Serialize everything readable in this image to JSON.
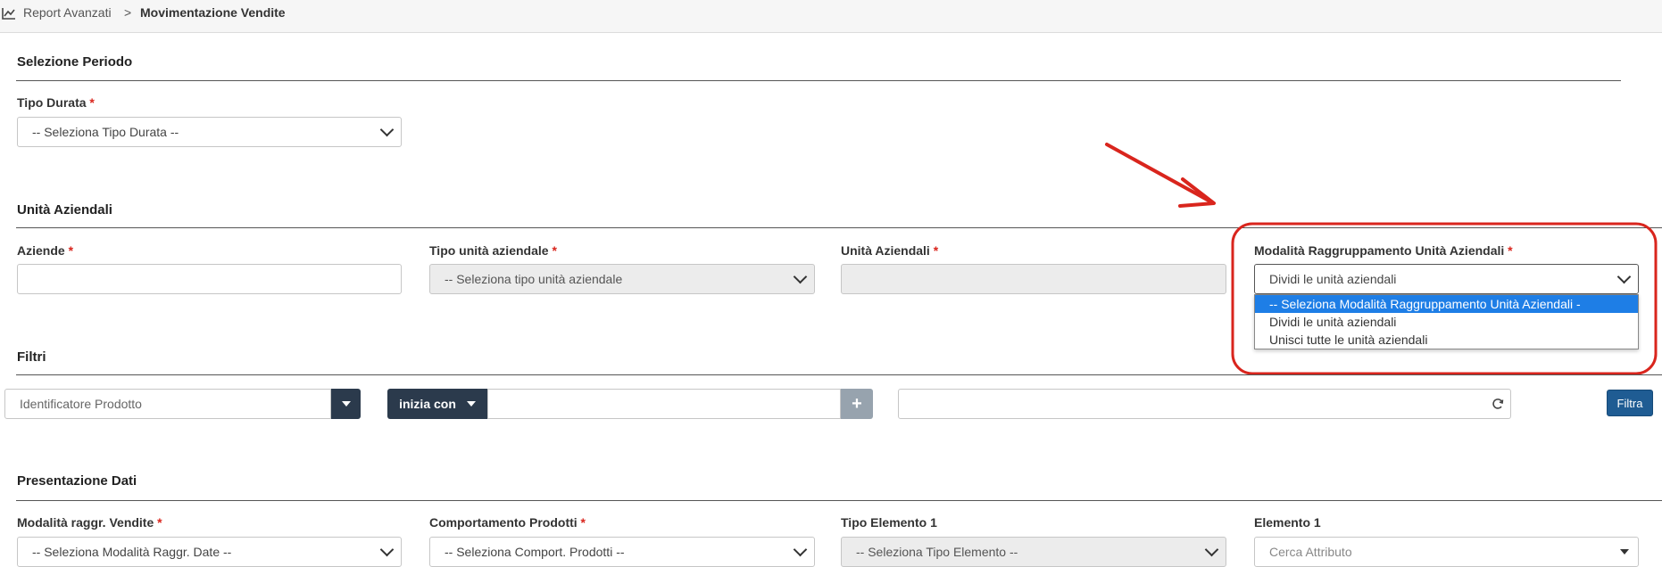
{
  "breadcrumb": {
    "parent": "Report Avanzati",
    "separator": ">",
    "current": "Movimentazione Vendite"
  },
  "sections": {
    "periodo": "Selezione Periodo",
    "unita": "Unità Aziendali",
    "filtri": "Filtri",
    "presentazione": "Presentazione Dati"
  },
  "required_mark": "*",
  "periodo": {
    "tipo_durata_label": "Tipo Durata",
    "tipo_durata_value": "-- Seleziona Tipo Durata --"
  },
  "unita": {
    "aziende_label": "Aziende",
    "aziende_value": "",
    "tipo_unita_label": "Tipo unità aziendale",
    "tipo_unita_value": "-- Seleziona tipo unità aziendale",
    "unita_label": "Unità Aziendali",
    "unita_value": "",
    "modalita_label": "Modalità Raggruppamento Unità Aziendali",
    "modalita_value": "Dividi le unità aziendali",
    "modalita_options": [
      "-- Seleziona Modalità Raggruppamento Unità Aziendali -",
      "Dividi le unità aziendali",
      "Unisci tutte le unità aziendali"
    ],
    "modalita_highlighted_index": 0
  },
  "filtri": {
    "identificatore_value": "Identificatore Prodotto",
    "operator_label": "inizia con",
    "text_value": "",
    "add_label": "+",
    "refresh_icon": "refresh-icon",
    "filtra_label": "Filtra"
  },
  "presentazione": {
    "modalita_vendite_label": "Modalità raggr. Vendite",
    "modalita_vendite_value": "-- Seleziona Modalità Raggr. Date --",
    "comportamento_label": "Comportamento Prodotti",
    "comportamento_value": "-- Seleziona Comport. Prodotti --",
    "tipo_elemento_label": "Tipo Elemento 1",
    "tipo_elemento_value": "-- Seleziona Tipo Elemento --",
    "elemento_label": "Elemento 1",
    "elemento_placeholder": "Cerca Attributo"
  },
  "annotation": {
    "color": "#d9251d"
  }
}
